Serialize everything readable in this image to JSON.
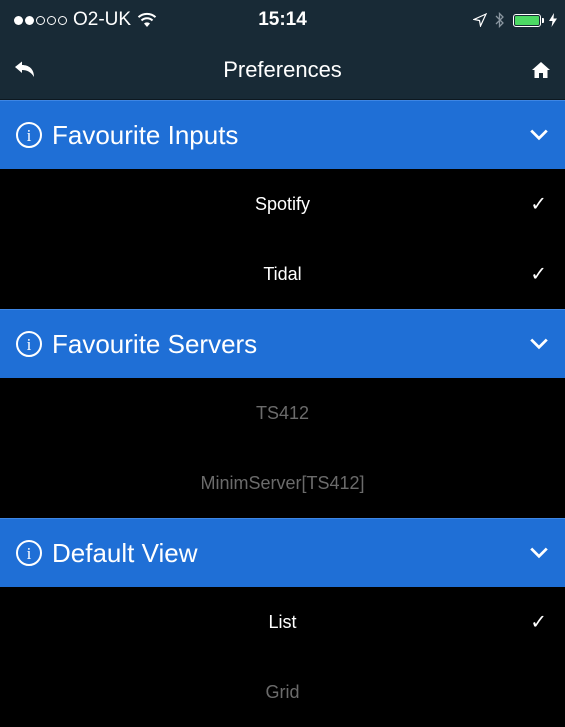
{
  "status": {
    "carrier": "O2-UK",
    "time": "15:14",
    "signal_filled": 2,
    "signal_total": 5,
    "battery_color": "#4cd964"
  },
  "nav": {
    "title": "Preferences",
    "back_icon": "back-arrow-icon",
    "home_icon": "home-icon"
  },
  "sections": [
    {
      "title": "Favourite Inputs",
      "items": [
        {
          "label": "Spotify",
          "checked": true,
          "enabled": true
        },
        {
          "label": "Tidal",
          "checked": true,
          "enabled": true
        }
      ]
    },
    {
      "title": "Favourite Servers",
      "items": [
        {
          "label": "TS412",
          "checked": false,
          "enabled": false
        },
        {
          "label": "MinimServer[TS412]",
          "checked": false,
          "enabled": false
        }
      ]
    },
    {
      "title": "Default View",
      "items": [
        {
          "label": "List",
          "checked": true,
          "enabled": true
        },
        {
          "label": "Grid",
          "checked": false,
          "enabled": false
        }
      ]
    }
  ],
  "check_mark": "✓",
  "info_glyph": "i",
  "colors": {
    "header_bg": "#1f6fd6",
    "bar_bg": "#182a36",
    "disabled_text": "#6b6b6b"
  }
}
